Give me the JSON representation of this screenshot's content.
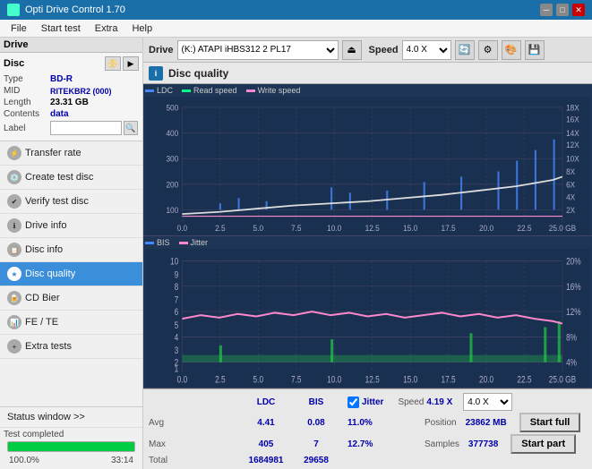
{
  "app": {
    "title": "Opti Drive Control 1.70",
    "icon": "disc-icon"
  },
  "titlebar": {
    "minimize_label": "─",
    "maximize_label": "□",
    "close_label": "✕"
  },
  "menu": {
    "items": [
      "File",
      "Start test",
      "Extra",
      "Help"
    ]
  },
  "toolbar": {
    "drive_label": "Drive",
    "drive_value": "(K:)  ATAPI iHBS312  2 PL17",
    "speed_label": "Speed",
    "speed_value": "4.0 X"
  },
  "disc": {
    "title": "Disc",
    "type_label": "Type",
    "type_value": "BD-R",
    "mid_label": "MID",
    "mid_value": "RITEKBR2 (000)",
    "length_label": "Length",
    "length_value": "23.31 GB",
    "contents_label": "Contents",
    "contents_value": "data",
    "label_label": "Label",
    "label_value": ""
  },
  "nav": {
    "items": [
      {
        "id": "transfer-rate",
        "label": "Transfer rate",
        "active": false
      },
      {
        "id": "create-test-disc",
        "label": "Create test disc",
        "active": false
      },
      {
        "id": "verify-test-disc",
        "label": "Verify test disc",
        "active": false
      },
      {
        "id": "drive-info",
        "label": "Drive info",
        "active": false
      },
      {
        "id": "disc-info",
        "label": "Disc info",
        "active": false
      },
      {
        "id": "disc-quality",
        "label": "Disc quality",
        "active": true
      },
      {
        "id": "cd-bier",
        "label": "CD Bier",
        "active": false
      },
      {
        "id": "fe-te",
        "label": "FE / TE",
        "active": false
      },
      {
        "id": "extra-tests",
        "label": "Extra tests",
        "active": false
      }
    ]
  },
  "status": {
    "window_label": "Status window >>",
    "progress": 100,
    "completed_label": "Test completed",
    "time": "33:14"
  },
  "disc_quality": {
    "title": "Disc quality",
    "icon_label": "i",
    "legend": {
      "ldc": "LDC",
      "read": "Read speed",
      "write": "Write speed",
      "bis": "BIS",
      "jitter": "Jitter"
    },
    "top_chart": {
      "y_max": 500,
      "y_left_labels": [
        "500",
        "400",
        "300",
        "200",
        "100"
      ],
      "y_right_labels": [
        "18X",
        "16X",
        "14X",
        "12X",
        "10X",
        "8X",
        "6X",
        "4X",
        "2X"
      ],
      "x_labels": [
        "0.0",
        "2.5",
        "5.0",
        "7.5",
        "10.0",
        "12.5",
        "15.0",
        "17.5",
        "20.0",
        "22.5",
        "25.0 GB"
      ]
    },
    "bottom_chart": {
      "y_max": 10,
      "y_left_labels": [
        "10",
        "9",
        "8",
        "7",
        "6",
        "5",
        "4",
        "3",
        "2",
        "1"
      ],
      "y_right_labels": [
        "20%",
        "16%",
        "12%",
        "8%",
        "4%"
      ],
      "x_labels": [
        "0.0",
        "2.5",
        "5.0",
        "7.5",
        "10.0",
        "12.5",
        "15.0",
        "17.5",
        "20.0",
        "22.5",
        "25.0 GB"
      ]
    },
    "stats": {
      "ldc_label": "LDC",
      "bis_label": "BIS",
      "jitter_label": "Jitter",
      "speed_label": "Speed",
      "avg_label": "Avg",
      "max_label": "Max",
      "total_label": "Total",
      "position_label": "Position",
      "samples_label": "Samples",
      "ldc_avg": "4.41",
      "ldc_max": "405",
      "ldc_total": "1684981",
      "bis_avg": "0.08",
      "bis_max": "7",
      "bis_total": "29658",
      "jitter_avg": "11.0%",
      "jitter_max": "12.7%",
      "speed_val": "4.19 X",
      "speed_drop": "4.0 X",
      "position_val": "23862 MB",
      "samples_val": "377738",
      "start_full_label": "Start full",
      "start_part_label": "Start part"
    }
  }
}
